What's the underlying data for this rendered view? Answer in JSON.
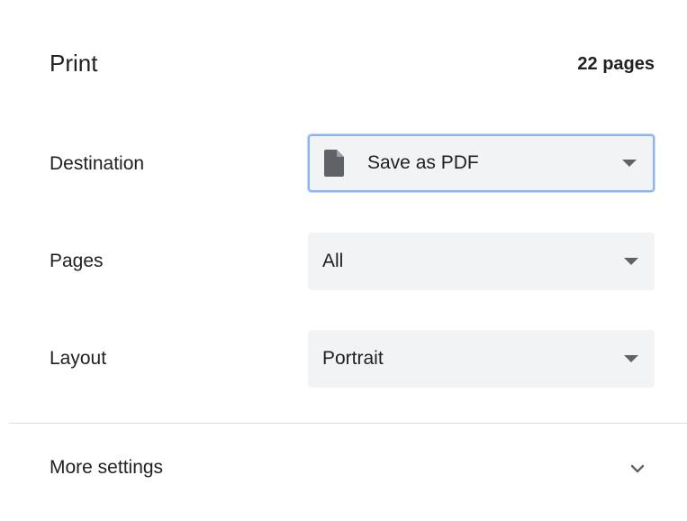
{
  "header": {
    "title": "Print",
    "page_count": "22 pages"
  },
  "destination": {
    "label": "Destination",
    "value": "Save as PDF",
    "icon": "file-icon"
  },
  "pages": {
    "label": "Pages",
    "value": "All"
  },
  "layout": {
    "label": "Layout",
    "value": "Portrait"
  },
  "more_settings": {
    "label": "More settings",
    "icon": "chevron-down-icon"
  },
  "colors": {
    "focus_border": "#8ab4f8",
    "select_bg": "#f1f3f4",
    "text": "#202124",
    "icon": "#5f6368"
  }
}
